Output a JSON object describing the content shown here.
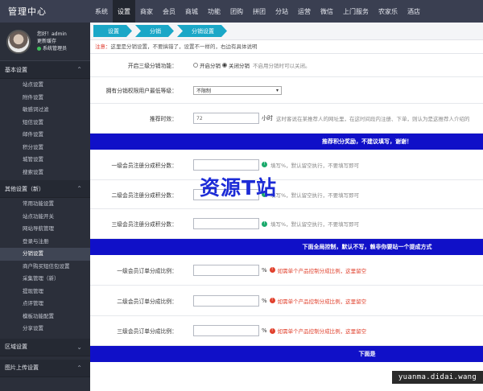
{
  "brand": "管理中心",
  "topnav": [
    "系统",
    "设置",
    "商家",
    "会员",
    "商城",
    "功能",
    "团购",
    "拼团",
    "分站",
    "运营",
    "微信",
    "上门服务",
    "农家乐",
    "酒店"
  ],
  "profile": {
    "greeting": "您好！admin",
    "clear_cache": "更新缓存",
    "role": "系统管理员"
  },
  "sidebar": {
    "group1": "基本设置",
    "group1_items": [
      "站点设置",
      "附件设置",
      "敏感词过滤",
      "短信设置",
      "邮件设置",
      "积分设置",
      "城管设置",
      "搜索设置"
    ],
    "group2": "其他设置（新）",
    "group2_items": [
      "常用功能设置",
      "站点功能开关",
      "网站导航管理",
      "登录与注册",
      "分销设置",
      "商户购买短信包设置",
      "采集管理（新）",
      "提现管理",
      "点评管理",
      "模板功能配置",
      "分享设置"
    ],
    "group3": "区域设置",
    "group4": "图片上传设置"
  },
  "breadcrumbs": [
    "设置",
    "分销",
    "分销设置"
  ],
  "notice": {
    "label": "注意：",
    "text": "这里是分销设置，不要搞错了，设置不一样的，右边有具体说明"
  },
  "form": {
    "enable": {
      "label": "开启三级分销功能：",
      "opt_on": "开启分销",
      "opt_off": "关闭分销",
      "hint": "不启用分销时可以关闭。"
    },
    "min_level": {
      "label": "拥有分销权限用户最低等级：",
      "value": "不限制"
    },
    "time": {
      "label": "推荐时效：",
      "value": "72",
      "unit": "小时",
      "hint": "这时客说在某推荐人的网址里，在这时间段内注册、下单，则认为是这推荐人介绍的"
    },
    "banner1": "推荐积分奖励，不建议填写，谢谢！",
    "lvl1_points": {
      "label": "一级会员注册分成积分数："
    },
    "lvl2_points": {
      "label": "二级会员注册分成积分数：",
      "hint": "填写%，默认留空执行，不要填写即可"
    },
    "lvl3_points": {
      "label": "三级会员注册分成积分数：",
      "hint": "填写%，默认留空执行，不要填写即可"
    },
    "lvl1_hint": "填写%，默认留空执行，不要填写即可",
    "banner2": "下面全局控制，默认不写，赖非你要站一个提成方式",
    "lvl1_order": {
      "label": "一级会员订单分成比例：",
      "unit": "%",
      "hint": "如需单个产品控制分成比例，这里留空"
    },
    "lvl2_order": {
      "label": "二级会员订单分成比例：",
      "unit": "%",
      "hint": "如需单个产品控制分成比例，这里留空"
    },
    "lvl3_order": {
      "label": "三级会员订单分成比例：",
      "unit": "%",
      "hint": "如需单个产品控制分成比例，这里留空"
    },
    "banner3": "下面是"
  },
  "watermark": "资源T站",
  "url_mark": "yuanma.didai.wang"
}
